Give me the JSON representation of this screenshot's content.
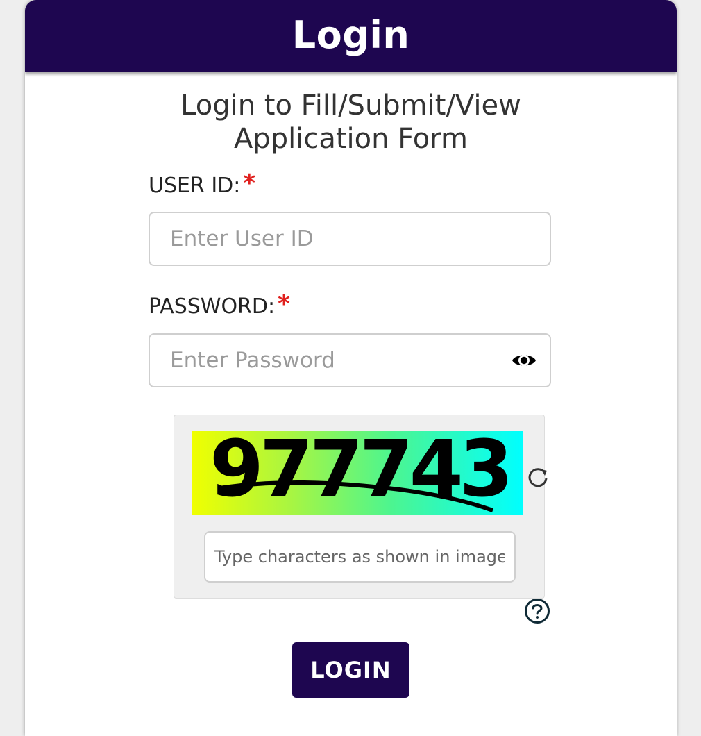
{
  "header": {
    "title": "Login"
  },
  "subtitle": {
    "line1": "Login to Fill/Submit/View",
    "line2": "Application Form"
  },
  "user_id": {
    "label": "USER ID:",
    "required_mark": "*",
    "placeholder": "Enter User ID",
    "value": ""
  },
  "password": {
    "label": "PASSWORD:",
    "required_mark": "*",
    "placeholder": "Enter Password",
    "value": "",
    "toggle_icon": "eye-icon"
  },
  "captcha": {
    "image_text": "977743",
    "refresh_icon": "refresh-icon",
    "input_placeholder": "Type characters as shown in image",
    "input_value": "",
    "help_icon": "question-circle-icon"
  },
  "login_button": {
    "label": "LOGIN"
  },
  "colors": {
    "primary": "#1e0650",
    "required": "#e0201e",
    "background": "#eeeeee"
  }
}
